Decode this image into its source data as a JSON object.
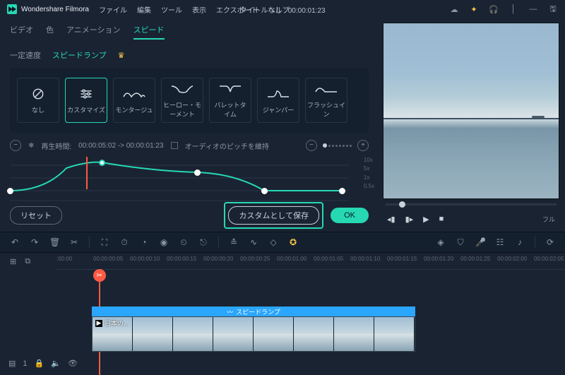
{
  "titlebar": {
    "app_name": "Wondershare Filmora",
    "menus": [
      "ファイル",
      "編集",
      "ツール",
      "表示",
      "エクスポート",
      "ヘルプ"
    ],
    "project_title": "タイトルなし : 00:00:01:23"
  },
  "prop_tabs": {
    "items": [
      "ビデオ",
      "色",
      "アニメーション",
      "スピード"
    ],
    "active": 3
  },
  "sub_tabs": {
    "items": [
      "一定速度",
      "スピードランプ"
    ],
    "active": 1
  },
  "presets": [
    {
      "label": "なし",
      "glyph": "none"
    },
    {
      "label": "カスタマイズ",
      "glyph": "sliders"
    },
    {
      "label": "モンタージュ",
      "glyph": "wave1"
    },
    {
      "label": "ヒーロー・モーメント",
      "glyph": "wave2"
    },
    {
      "label": "バレットタイム",
      "glyph": "wave3"
    },
    {
      "label": "ジャンパー",
      "glyph": "wave4"
    },
    {
      "label": "フラッシュイン",
      "glyph": "wave5"
    }
  ],
  "preset_active": 1,
  "ramp": {
    "duration_label": "再生時間:",
    "duration_value": "00:00:05:02 -> 00:00:01:23",
    "pitch_label": "オーディオのピッチを維持",
    "axis": [
      "10x",
      "5x",
      "1x",
      "0.5x"
    ]
  },
  "buttons": {
    "reset": "リセット",
    "save_custom": "カスタムとして保存",
    "ok": "OK"
  },
  "preview": {
    "full": "フル"
  },
  "ruler": {
    "start": ":00:00",
    "ticks": [
      "00:00:00:05",
      "00:00:00:10",
      "00:00:00:15",
      "00:00:00:20",
      "00:00:00:25",
      "00:00:01:00",
      "00:00:01:05",
      "00:00:01:10",
      "00:00:01:15",
      "00:00:01:20",
      "00:00:01:25",
      "00:00:02:00",
      "00:00:02:05"
    ]
  },
  "clip": {
    "speed_label": "スピードランプ",
    "title": "日本の..."
  },
  "track_info": {
    "index": "1"
  }
}
